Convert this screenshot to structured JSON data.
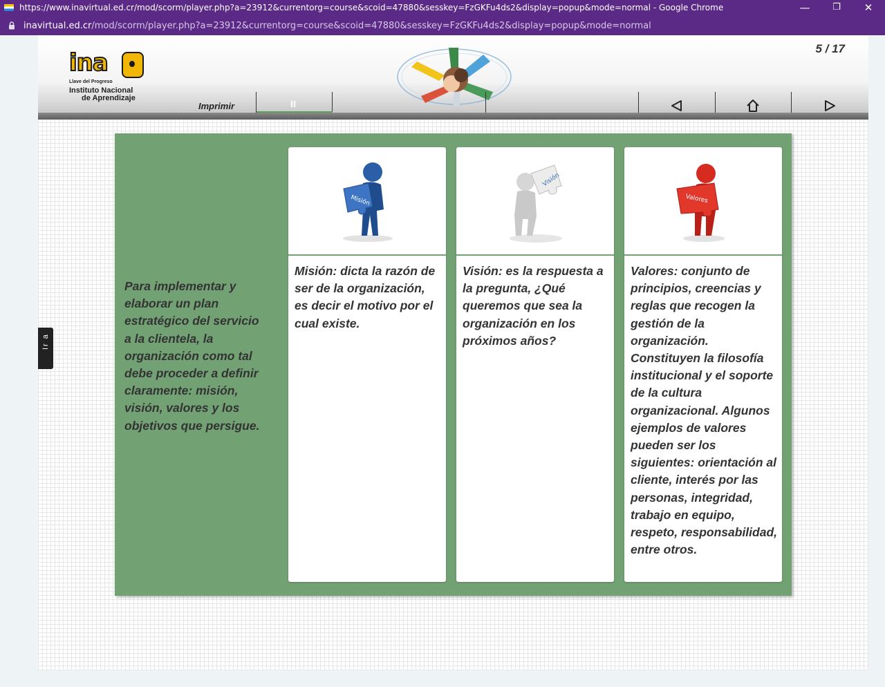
{
  "browser": {
    "window_title": "https://www.inavirtual.ed.cr/mod/scorm/player.php?a=23912&currentorg=course&scoid=47880&sesskey=FzGKFu4ds2&display=popup&mode=normal - Google Chrome",
    "url_host": "inavirtual.ed.cr",
    "url_path": "/mod/scorm/player.php?a=23912&currentorg=course&scoid=47880&sesskey=FzGKFu4ds2&display=popup&mode=normal",
    "minimize_glyph": "—",
    "restore_glyph": "❐",
    "close_glyph": "✕",
    "theme_color": "#5b2a86"
  },
  "header": {
    "logo": {
      "wordmark": "ina",
      "tagline": "Llave del Progreso",
      "name_line1": "Instituto Nacional",
      "name_line2": "de Aprendizaje"
    },
    "page_counter": "5 / 17",
    "print_label": "Imprimir",
    "icons": [
      "pause-icon",
      "previous-icon",
      "home-icon",
      "next-icon"
    ]
  },
  "side_tab": {
    "label": "Ir a"
  },
  "content": {
    "panel_color": "#72a274",
    "intro": "Para implementar y elaborar un plan estratégico del servicio a la clientela, la organización como tal debe proceder a definir claramente: misión, visión, valores y los objetivos que persigue.",
    "cards": [
      {
        "figure_label": "Misión",
        "figure_color": "#2a5fa8",
        "text": "Misión: dicta la razón de ser de la organización, es decir el motivo por el cual existe."
      },
      {
        "figure_label": "Visión",
        "figure_color": "#d8d8d8",
        "text": "Visión: es la respuesta a la pregunta, ¿Qué queremos que sea la organización en los próximos años?"
      },
      {
        "figure_label": "Valores",
        "figure_color": "#d62b1f",
        "text": "Valores: conjunto de principios, creencias y reglas que recogen la gestión de la organización. Constituyen la filosofía institucional y el soporte de la cultura organizacional. Algunos ejemplos de valores pueden ser los siguientes: orientación al cliente, interés por las personas, integridad, trabajo en equipo, respeto, responsabilidad, entre otros."
      }
    ]
  }
}
